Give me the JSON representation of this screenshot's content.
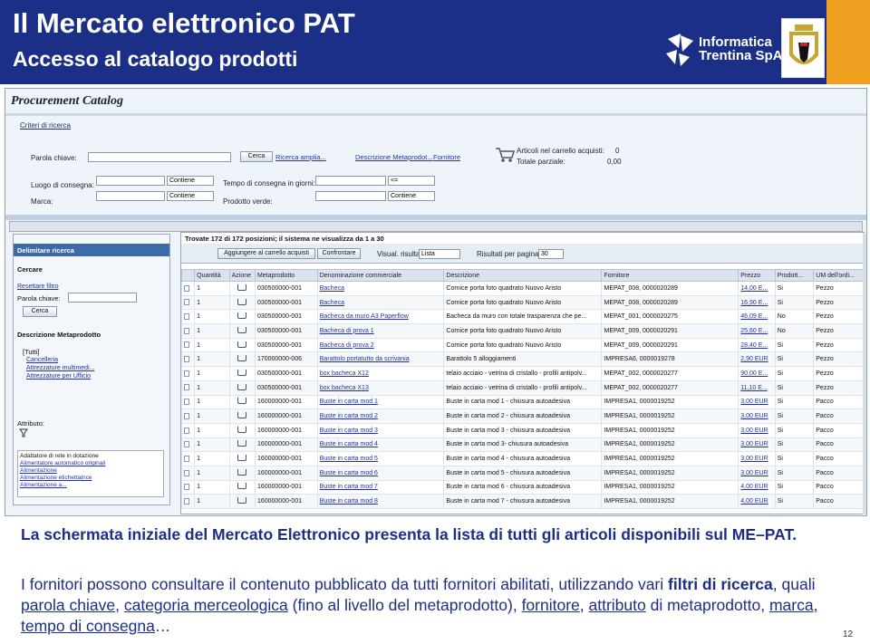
{
  "header": {
    "title": "Il Mercato elettronico PAT",
    "subtitle": "Accesso al catalogo prodotti",
    "logo_line1": "Informatica",
    "logo_line2": "Trentina SpA"
  },
  "catalog": {
    "title": "Procurement Catalog",
    "criteria_link": "Criteri di ricerca",
    "search": {
      "keyword_label": "Parola chiave:",
      "search_btn": "Cerca",
      "advanced_link": "Ricerca amplia...",
      "desc_link": "Descrizione Metaprodot...",
      "supplier_link": "Fornitore",
      "cart_items_label": "Articoli nel carrello acquisti:",
      "cart_items_value": "0",
      "partial_total_label": "Totale parziale:",
      "partial_total_value": "0,00",
      "delivery_place_label": "Luogo di consegna:",
      "contains1": "Contiene",
      "delivery_time_label": "Tempo di consegna in giorni:",
      "op": "<=",
      "brand_label": "Marca:",
      "contains2": "Contiene",
      "green_label": "Prodotto verde:",
      "contains3": "Contiene"
    }
  },
  "left": {
    "header": "Delimitare ricerca",
    "search_title": "Cercare",
    "reset_link": "Resettare filtro",
    "keyword_label": "Parola chiave:",
    "search_btn": "Cerca",
    "meta_title": "Descrizione Metaprodotto",
    "tree": [
      "[Tutti]",
      "Cancelleria",
      "Attrezzature multimedi...",
      "Attrezzature per Ufficio"
    ],
    "attr_label": "Attributo:",
    "attr_items": [
      "Adattatore di rete in dotazione",
      "Alimentatore automatico originali",
      "Alimentazione",
      "Alimentazione etichettatrice",
      "Alimentazione a..."
    ]
  },
  "results": {
    "summary": "Trovate 172 di 172 posizioni; il sistema ne visualizza da 1 a 30",
    "add_btn": "Aggiungere al carrello acquisti",
    "compare_btn": "Confrontare",
    "view_label": "Visual. risultato:",
    "view_value": "Lista",
    "perpage_label": "Risultati per pagina:",
    "perpage_value": "30",
    "columns": [
      "Quantità",
      "Azione",
      "Metaprodotto",
      "Denominazione commerciale",
      "Descrizione",
      "Fornitore",
      "Prezzo",
      "Prodott...",
      "UM dell'ordi..."
    ],
    "rows": [
      [
        "1",
        "030500000-001",
        "Bacheca",
        "Cornice porta foto quadrato Nuovo Aristo",
        "MEPAT_008, 0000020289",
        "14,00 E...",
        "Si",
        "Pezzo"
      ],
      [
        "1",
        "030500000-001",
        "Bacheca",
        "Cornice porta foto quadrato Nuovo Aristo",
        "MEPAT_008, 0000020289",
        "16,90 E...",
        "Si",
        "Pezzo"
      ],
      [
        "1",
        "030500000-001",
        "Bacheca da muro A3 Paperflow",
        "Bacheca da muro con totale trasparenza che pe...",
        "MEPAT_001, 0000020275",
        "46,09 E...",
        "No",
        "Pezzo"
      ],
      [
        "1",
        "030500000-001",
        "Bacheca di prova 1",
        "Cornice porta foto quadrato Nuovo Aristo",
        "MEPAT_009, 0000020291",
        "25,60 E...",
        "No",
        "Pezzo"
      ],
      [
        "1",
        "030500000-001",
        "Bacheca di prova 2",
        "Cornice porta foto quadrato Nuovo Aristo",
        "MEPAT_009, 0000020291",
        "28,40 E...",
        "Si",
        "Pezzo"
      ],
      [
        "1",
        "170000000-006",
        "Barattolo portatutto da scrivania",
        "Barattolo 5 alloggiamenti",
        "IMPRESA6, 0000019278",
        "2,90 EUR",
        "Si",
        "Pezzo"
      ],
      [
        "1",
        "030500000-001",
        "box bacheca X12",
        "telaio acciaio - vetrina di cristallo - profili antipolv...",
        "MEPAT_002, 0000020277",
        "90,00 E...",
        "Si",
        "Pezzo"
      ],
      [
        "1",
        "030500000-001",
        "box bacheca X13",
        "telaio acciaio - vetrina di cristallo - profili antipolv...",
        "MEPAT_002, 0000020277",
        "11,10 E...",
        "Si",
        "Pezzo"
      ],
      [
        "1",
        "160000000-001",
        "Buste in carta mod 1",
        "Buste in carta mod 1 - chiusura autoadesiva",
        "IMPRESA1, 0000019252",
        "3,00 EUR",
        "Si",
        "Pacco"
      ],
      [
        "1",
        "160000000-001",
        "Buste in carta mod 2",
        "Buste in carta mod 2 - chiusura autoadesiva",
        "IMPRESA1, 0000019252",
        "3,00 EUR",
        "Si",
        "Pacco"
      ],
      [
        "1",
        "160000000-001",
        "Buste in carta mod 3",
        "Buste in carta mod 3 - chiusura autoadesiva",
        "IMPRESA1, 0000019252",
        "3,00 EUR",
        "Si",
        "Pacco"
      ],
      [
        "1",
        "160000000-001",
        "Buste in carta mod 4",
        "Buste in carta mod 3- chiusura autoadesiva",
        "IMPRESA1, 0000019252",
        "3,00 EUR",
        "Si",
        "Pacco"
      ],
      [
        "1",
        "160000000-001",
        "Buste in carta mod 5",
        "Buste in carta mod 4 - chiusura autoadesiva",
        "IMPRESA1, 0000019252",
        "3,00 EUR",
        "Si",
        "Pacco"
      ],
      [
        "1",
        "160000000-001",
        "Buste in carta mod 6",
        "Buste in carta mod 5 - chiusura autoadesiva",
        "IMPRESA1, 0000019252",
        "3,00 EUR",
        "Si",
        "Pacco"
      ],
      [
        "1",
        "160000000-001",
        "Buste in carta mod 7",
        "Buste in carta mod 6 - chiusura autoadesiva",
        "IMPRESA1, 0000019252",
        "4,00 EUR",
        "Si",
        "Pacco"
      ],
      [
        "1",
        "160000000-001",
        "Buste in carta mod 8",
        "Buste in carta mod 7 - chiusura autoadesiva",
        "IMPRESA1, 0000019252",
        "4,00 EUR",
        "Si",
        "Pacco"
      ]
    ]
  },
  "caption": {
    "bold_line": "La schermata iniziale del Mercato Elettronico presenta  la lista di tutti gli articoli disponibili sul ME–PAT.",
    "p1": "I fornitori possono consultare il contenuto pubblicato da tutti fornitori abilitati, utilizzando vari ",
    "p2": "filtri di ricerca",
    "p3": ", quali ",
    "k1": "parola chiave",
    "sep1": ", ",
    "k2": "categoria merceologica",
    "p4": " (fino al livello del metaprodotto), ",
    "k3": "fornitore",
    "sep2": ", ",
    "k4": "attributo",
    "p5": " di metaprodotto, ",
    "k5": "marca",
    "sep3": ", ",
    "k6": "tempo di consegna",
    "p6": "…"
  },
  "page_number": "12"
}
